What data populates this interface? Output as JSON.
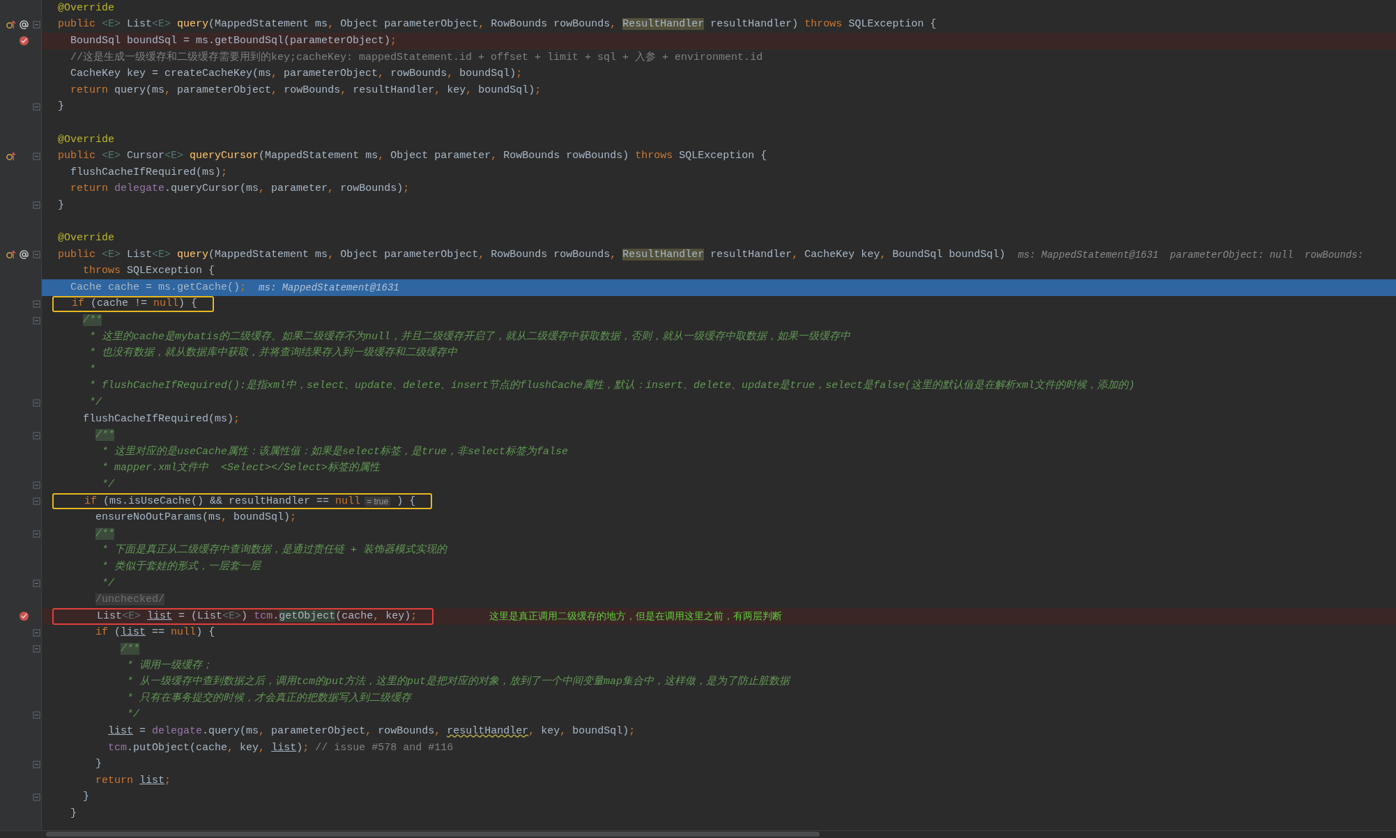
{
  "editor": {
    "lines": [
      {
        "parts": [
          {
            "kind": "code",
            "tokens": [
              {
                "kind": "a",
                "text": "@Override"
              }
            ]
          }
        ]
      },
      {
        "overrides": true,
        "annotated": true,
        "fold": true,
        "parts": [
          {
            "kind": "code",
            "tokens": [
              {
                "kind": "k",
                "text": "public "
              },
              {
                "kind": "g",
                "text": "<E>"
              },
              {
                "kind": "p",
                "text": " List"
              },
              {
                "kind": "g",
                "text": "<E> "
              },
              {
                "kind": "f",
                "text": "query"
              },
              {
                "kind": "p",
                "text": "(MappedStatement ms, Object parameterObject, RowBounds rowBounds, "
              },
              {
                "kind": "h",
                "text": "ResultHandler"
              },
              {
                "kind": "p",
                "text": " resultHandler) "
              },
              {
                "kind": "k",
                "text": "throws"
              },
              {
                "kind": "p",
                "text": " SQLException {"
              }
            ]
          }
        ]
      },
      {
        "breakpoint": true,
        "parts": [
          {
            "kind": "code",
            "tokens": [
              {
                "kind": "p",
                "text": "  BoundSql boundSql = ms.getBoundSql(parameterObject);"
              }
            ]
          }
        ]
      },
      {
        "parts": [
          {
            "kind": "code",
            "tokens": [
              {
                "kind": "c",
                "text": "  //这是生成一级缓存和二级缓存需要用到的key;cacheKey: mappedStatement.id + offset + limit + sql + 入参 + environment.id"
              }
            ]
          }
        ]
      },
      {
        "parts": [
          {
            "kind": "code",
            "tokens": [
              {
                "kind": "p",
                "text": "  CacheKey key = createCacheKey(ms, parameterObject, rowBounds, boundSql);"
              }
            ]
          }
        ]
      },
      {
        "parts": [
          {
            "kind": "code",
            "tokens": [
              {
                "kind": "k",
                "text": "  return"
              },
              {
                "kind": "p",
                "text": " query(ms, parameterObject, rowBounds, resultHandler, key, boundSql);"
              }
            ]
          }
        ]
      },
      {
        "fold": true,
        "parts": [
          {
            "kind": "code",
            "tokens": [
              {
                "kind": "p",
                "text": "}"
              }
            ]
          }
        ]
      },
      {
        "gap_before": true,
        "parts": [
          {
            "kind": "code",
            "tokens": [
              {
                "kind": "a",
                "text": "@Override"
              }
            ]
          }
        ]
      },
      {
        "overrides": true,
        "fold": true,
        "parts": [
          {
            "kind": "code",
            "tokens": [
              {
                "kind": "k",
                "text": "public "
              },
              {
                "kind": "g",
                "text": "<E>"
              },
              {
                "kind": "p",
                "text": " Cursor"
              },
              {
                "kind": "g",
                "text": "<E> "
              },
              {
                "kind": "f",
                "text": "queryCursor"
              },
              {
                "kind": "p",
                "text": "(MappedStatement ms, Object parameter, RowBounds rowBounds) "
              },
              {
                "kind": "k",
                "text": "throws"
              },
              {
                "kind": "p",
                "text": " SQLException {"
              }
            ]
          }
        ]
      },
      {
        "parts": [
          {
            "kind": "code",
            "tokens": [
              {
                "kind": "p",
                "text": "  flushCacheIfRequired(ms);"
              }
            ]
          }
        ]
      },
      {
        "parts": [
          {
            "kind": "code",
            "tokens": [
              {
                "kind": "k",
                "text": "  return "
              },
              {
                "kind": "m",
                "text": "delegate"
              },
              {
                "kind": "p",
                "text": ".queryCursor(ms, parameter, rowBounds);"
              }
            ]
          }
        ]
      },
      {
        "fold": true,
        "parts": [
          {
            "kind": "code",
            "tokens": [
              {
                "kind": "p",
                "text": "}"
              }
            ]
          }
        ]
      },
      {
        "gap_before": true,
        "parts": [
          {
            "kind": "code",
            "tokens": [
              {
                "kind": "a",
                "text": "@Override"
              }
            ]
          }
        ]
      },
      {
        "overrides": true,
        "annotated": true,
        "fold": true,
        "parts": [
          {
            "kind": "code",
            "tokens": [
              {
                "kind": "k",
                "text": "public "
              },
              {
                "kind": "g",
                "text": "<E>"
              },
              {
                "kind": "p",
                "text": " List"
              },
              {
                "kind": "g",
                "text": "<E> "
              },
              {
                "kind": "f",
                "text": "query"
              },
              {
                "kind": "p",
                "text": "(MappedStatement ms, Object parameterObject, RowBounds rowBounds, "
              },
              {
                "kind": "h",
                "text": "ResultHandler"
              },
              {
                "kind": "p",
                "text": " resultHandler, CacheKey key, BoundSql boundSql)"
              }
            ]
          },
          {
            "kind": "hint",
            "text": "ms: MappedStatement@1631  parameterObject: null  rowBounds:"
          }
        ]
      },
      {
        "parts": [
          {
            "kind": "code",
            "tokens": [
              {
                "kind": "k",
                "text": "    throws"
              },
              {
                "kind": "p",
                "text": " SQLException {"
              }
            ]
          }
        ]
      },
      {
        "current": true,
        "parts": [
          {
            "kind": "code",
            "tokens": [
              {
                "kind": "p",
                "text": "  Cache cache = ms.getCache();"
              }
            ]
          },
          {
            "kind": "hint",
            "text": "ms: MappedStatement@1631"
          }
        ]
      },
      {
        "fold": true,
        "frame": {
          "color": "#e8b820"
        },
        "parts": [
          {
            "kind": "code",
            "tokens": [
              {
                "kind": "k",
                "text": "  if"
              },
              {
                "kind": "p",
                "text": " (cache != "
              },
              {
                "kind": "k",
                "text": "null"
              },
              {
                "kind": "p",
                "text": ") {"
              }
            ]
          }
        ]
      },
      {
        "fold": true,
        "parts": [
          {
            "kind": "code",
            "tokens": [
              {
                "kind": "o",
                "text": "    /**"
              }
            ]
          }
        ]
      },
      {
        "parts": [
          {
            "kind": "code",
            "tokens": [
              {
                "kind": "d",
                "text": "     * 这里的cache是mybatis的二级缓存。如果二级缓存不为null，并且二级缓存开启了，就从二级缓存中获取数据，否则，就从一级缓存中取数据，如果一级缓存中"
              }
            ]
          }
        ]
      },
      {
        "parts": [
          {
            "kind": "code",
            "tokens": [
              {
                "kind": "d",
                "text": "     * 也没有数据，就从数据库中获取，并将查询结果存入到一级缓存和二级缓存中"
              }
            ]
          }
        ]
      },
      {
        "parts": [
          {
            "kind": "code",
            "tokens": [
              {
                "kind": "d",
                "text": "     *"
              }
            ]
          }
        ]
      },
      {
        "parts": [
          {
            "kind": "code",
            "tokens": [
              {
                "kind": "d",
                "text": "     * flushCacheIfRequired():是指xml中，select、update、delete、insert节点的flushCache属性，默认：insert、delete、update是true，select是false(这里的默认值是在解析xml文件的时候，添加的)"
              }
            ]
          }
        ]
      },
      {
        "fold": true,
        "parts": [
          {
            "kind": "code",
            "tokens": [
              {
                "kind": "d",
                "text": "     */"
              }
            ]
          }
        ]
      },
      {
        "parts": [
          {
            "kind": "code",
            "tokens": [
              {
                "kind": "p",
                "text": "    flushCacheIfRequired(ms);"
              }
            ]
          }
        ]
      },
      {
        "fold": true,
        "parts": [
          {
            "kind": "code",
            "tokens": [
              {
                "kind": "o",
                "text": "      /**"
              }
            ]
          }
        ]
      },
      {
        "parts": [
          {
            "kind": "code",
            "tokens": [
              {
                "kind": "d",
                "text": "       * 这里对应的是useCache属性：该属性值：如果是select标签，是true，非select标签为false"
              }
            ]
          }
        ]
      },
      {
        "parts": [
          {
            "kind": "code",
            "tokens": [
              {
                "kind": "d",
                "text": "       * mapper.xml文件中  <Select></Select>标签的属性"
              }
            ]
          }
        ]
      },
      {
        "fold": true,
        "parts": [
          {
            "kind": "code",
            "tokens": [
              {
                "kind": "d",
                "text": "       */"
              }
            ]
          }
        ]
      },
      {
        "fold": true,
        "frame": {
          "color": "#e8b820"
        },
        "parts": [
          {
            "kind": "code",
            "tokens": [
              {
                "kind": "k",
                "text": "    if"
              },
              {
                "kind": "p",
                "text": " (ms.isUseCache() && resultHandler == "
              },
              {
                "kind": "k",
                "text": "null"
              }
            ]
          },
          {
            "kind": "value",
            "text": "= true"
          },
          {
            "kind": "code",
            "tokens": [
              {
                "kind": "p",
                "text": " ) {"
              }
            ]
          }
        ]
      },
      {
        "parts": [
          {
            "kind": "code",
            "tokens": [
              {
                "kind": "p",
                "text": "      ensureNoOutParams(ms, boundSql);"
              }
            ]
          }
        ]
      },
      {
        "fold": true,
        "parts": [
          {
            "kind": "code",
            "tokens": [
              {
                "kind": "o",
                "text": "      /**"
              }
            ]
          }
        ]
      },
      {
        "parts": [
          {
            "kind": "code",
            "tokens": [
              {
                "kind": "d",
                "text": "       * 下面是真正从二级缓存中查询数据，是通过责任链 + 装饰器模式实现的"
              }
            ]
          }
        ]
      },
      {
        "parts": [
          {
            "kind": "code",
            "tokens": [
              {
                "kind": "d",
                "text": "       * 类似于套娃的形式，一层套一层"
              }
            ]
          }
        ]
      },
      {
        "fold": true,
        "parts": [
          {
            "kind": "code",
            "tokens": [
              {
                "kind": "d",
                "text": "       */"
              }
            ]
          }
        ]
      },
      {
        "parts": [
          {
            "kind": "code",
            "tokens": [
              {
                "kind": "s",
                "text": "      /unchecked/"
              }
            ]
          }
        ]
      },
      {
        "breakpoint": true,
        "frame": {
          "color": "#e0403c"
        },
        "parts": [
          {
            "kind": "code",
            "tokens": [
              {
                "kind": "p",
                "text": "      List"
              },
              {
                "kind": "g",
                "text": "<E> "
              },
              {
                "kind": "u",
                "text": "list"
              },
              {
                "kind": "p",
                "text": " = (List"
              },
              {
                "kind": "g",
                "text": "<E>"
              },
              {
                "kind": "p",
                "text": ") "
              },
              {
                "kind": "m",
                "text": "tcm"
              },
              {
                "kind": "p",
                "text": "."
              },
              {
                "kind": "e",
                "text": "getObject"
              },
              {
                "kind": "p",
                "text": "(cache, key);"
              }
            ]
          },
          {
            "kind": "note",
            "text": "这里是真正调用二级缓存的地方，但是在调用这里之前，有两层判断"
          }
        ]
      },
      {
        "fold": true,
        "parts": [
          {
            "kind": "code",
            "tokens": [
              {
                "kind": "k",
                "text": "      if"
              },
              {
                "kind": "p",
                "text": " ("
              },
              {
                "kind": "u",
                "text": "list"
              },
              {
                "kind": "p",
                "text": " == "
              },
              {
                "kind": "k",
                "text": "null"
              },
              {
                "kind": "p",
                "text": ") {"
              }
            ]
          }
        ]
      },
      {
        "fold": true,
        "parts": [
          {
            "kind": "code",
            "tokens": [
              {
                "kind": "o",
                "text": "          /**"
              }
            ]
          }
        ]
      },
      {
        "parts": [
          {
            "kind": "code",
            "tokens": [
              {
                "kind": "d",
                "text": "           * 调用一级缓存；"
              }
            ]
          }
        ]
      },
      {
        "parts": [
          {
            "kind": "code",
            "tokens": [
              {
                "kind": "d",
                "text": "           * 从一级缓存中查到数据之后，调用tcm的put方法，这里的put是把对应的对象，放到了一个中间变量map集合中，这样做，是为了防止脏数据"
              }
            ]
          }
        ]
      },
      {
        "parts": [
          {
            "kind": "code",
            "tokens": [
              {
                "kind": "d",
                "text": "           * 只有在事务提交的时候，才会真正的把数据写入到二级缓存"
              }
            ]
          }
        ]
      },
      {
        "fold": true,
        "parts": [
          {
            "kind": "code",
            "tokens": [
              {
                "kind": "d",
                "text": "           */"
              }
            ]
          }
        ]
      },
      {
        "parts": [
          {
            "kind": "code",
            "tokens": [
              {
                "kind": "u",
                "text": "        list"
              },
              {
                "kind": "p",
                "text": " = "
              },
              {
                "kind": "m",
                "text": "delegate"
              },
              {
                "kind": "p",
                "text": ".query(ms, parameterObject, rowBounds, "
              },
              {
                "kind": "w",
                "text": "resultHandler"
              },
              {
                "kind": "p",
                "text": ", key, boundSql);"
              }
            ]
          }
        ]
      },
      {
        "parts": [
          {
            "kind": "code",
            "tokens": [
              {
                "kind": "m",
                "text": "        tcm"
              },
              {
                "kind": "p",
                "text": ".putObject(cache, key, "
              },
              {
                "kind": "u",
                "text": "list"
              },
              {
                "kind": "p",
                "text": "); "
              },
              {
                "kind": "c",
                "text": "// issue #578 and #116"
              }
            ]
          }
        ]
      },
      {
        "fold": true,
        "parts": [
          {
            "kind": "code",
            "tokens": [
              {
                "kind": "p",
                "text": "      }"
              }
            ]
          }
        ]
      },
      {
        "parts": [
          {
            "kind": "code",
            "tokens": [
              {
                "kind": "k",
                "text": "      return "
              },
              {
                "kind": "u",
                "text": "list"
              },
              {
                "kind": "p",
                "text": ";"
              }
            ]
          }
        ]
      },
      {
        "fold": true,
        "parts": [
          {
            "kind": "code",
            "tokens": [
              {
                "kind": "p",
                "text": "    }"
              }
            ]
          }
        ]
      },
      {
        "parts": [
          {
            "kind": "code",
            "tokens": [
              {
                "kind": "p",
                "text": "  }"
              }
            ]
          }
        ]
      }
    ]
  }
}
